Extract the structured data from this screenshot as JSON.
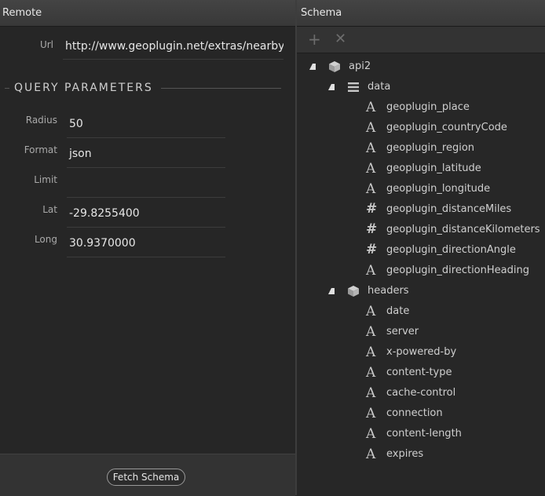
{
  "remote": {
    "title": "Remote",
    "url_label": "Url",
    "url_value": "http://www.geoplugin.net/extras/nearby",
    "section_title": "QUERY PARAMETERS",
    "params": [
      {
        "label": "Radius",
        "value": "50"
      },
      {
        "label": "Format",
        "value": "json"
      },
      {
        "label": "Limit",
        "value": ""
      },
      {
        "label": "Lat",
        "value": "-29.8255400"
      },
      {
        "label": "Long",
        "value": "30.9370000"
      }
    ],
    "fetch_button": "Fetch Schema"
  },
  "schema": {
    "title": "Schema",
    "toolbar": {
      "add_icon": "+",
      "remove_icon": "✕"
    },
    "tree": [
      {
        "label": "api2",
        "icon": "cube-icon",
        "level": 0,
        "expanded": true
      },
      {
        "label": "data",
        "icon": "list-icon",
        "level": 1,
        "expanded": true
      },
      {
        "label": "geoplugin_place",
        "icon": "text-icon",
        "level": 2
      },
      {
        "label": "geoplugin_countryCode",
        "icon": "text-icon",
        "level": 2
      },
      {
        "label": "geoplugin_region",
        "icon": "text-icon",
        "level": 2
      },
      {
        "label": "geoplugin_latitude",
        "icon": "text-icon",
        "level": 2
      },
      {
        "label": "geoplugin_longitude",
        "icon": "text-icon",
        "level": 2
      },
      {
        "label": "geoplugin_distanceMiles",
        "icon": "number-icon",
        "level": 2
      },
      {
        "label": "geoplugin_distanceKilometers",
        "icon": "number-icon",
        "level": 2
      },
      {
        "label": "geoplugin_directionAngle",
        "icon": "number-icon",
        "level": 2
      },
      {
        "label": "geoplugin_directionHeading",
        "icon": "text-icon",
        "level": 2
      },
      {
        "label": "headers",
        "icon": "cube-icon",
        "level": 1,
        "expanded": true
      },
      {
        "label": "date",
        "icon": "text-icon",
        "level": 2
      },
      {
        "label": "server",
        "icon": "text-icon",
        "level": 2
      },
      {
        "label": "x-powered-by",
        "icon": "text-icon",
        "level": 2
      },
      {
        "label": "content-type",
        "icon": "text-icon",
        "level": 2
      },
      {
        "label": "cache-control",
        "icon": "text-icon",
        "level": 2
      },
      {
        "label": "connection",
        "icon": "text-icon",
        "level": 2
      },
      {
        "label": "content-length",
        "icon": "text-icon",
        "level": 2
      },
      {
        "label": "expires",
        "icon": "text-icon",
        "level": 2
      }
    ]
  }
}
